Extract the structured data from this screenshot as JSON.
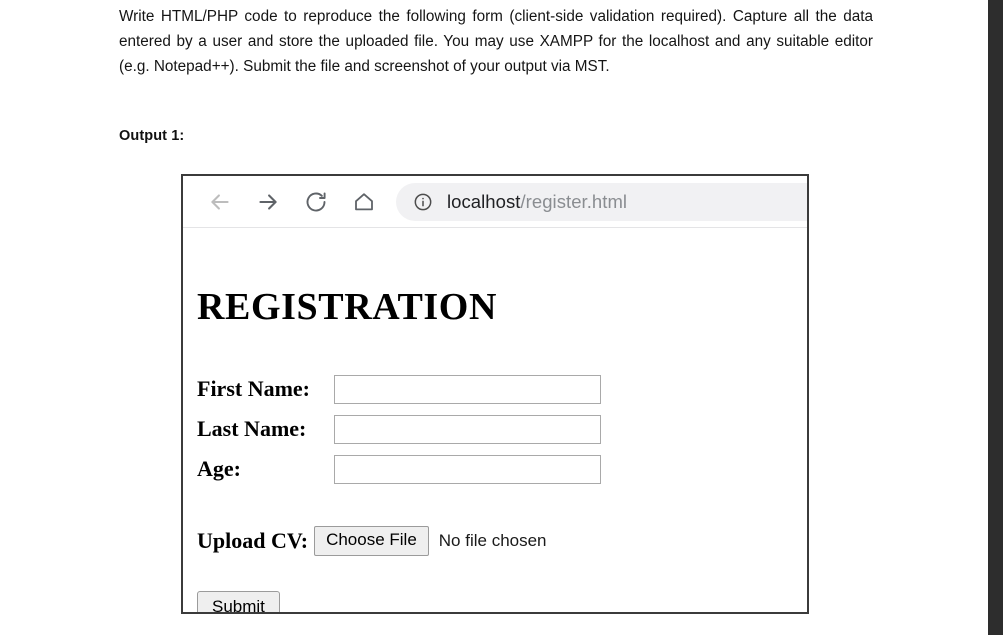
{
  "prompt": {
    "text": "Write HTML/PHP code to reproduce the following form (client-side validation required). Capture all the data entered by a user and store the uploaded file. You may use XAMPP for the localhost and any suitable editor (e.g. Notepad++). Submit the file and screenshot of your output via MST.",
    "output_label": "Output 1:"
  },
  "browser": {
    "toolbar": {
      "back_icon": "back-arrow-icon",
      "forward_icon": "forward-arrow-icon",
      "reload_icon": "reload-icon",
      "home_icon": "home-icon",
      "info_icon": "info-circle-icon"
    },
    "omnibox": {
      "host": "localhost",
      "path": "/register.html",
      "full_url": "localhost/register.html"
    }
  },
  "page": {
    "heading": "REGISTRATION",
    "fields": [
      {
        "label": "First Name:",
        "value": "",
        "placeholder": ""
      },
      {
        "label": "Last Name:",
        "value": "",
        "placeholder": ""
      },
      {
        "label": "Age:",
        "value": "",
        "placeholder": ""
      }
    ],
    "upload": {
      "label": "Upload CV:",
      "button_label": "Choose File",
      "status_text": "No file chosen"
    },
    "submit_label": "Submit"
  },
  "colors": {
    "frame_border": "#3b3b3b",
    "omnibox_bg": "#f1f1f3",
    "button_bg": "#efefef",
    "input_border": "#a9a9a9",
    "url_path_gray": "#8a8d91",
    "page_edge": "#2d2d2d"
  }
}
